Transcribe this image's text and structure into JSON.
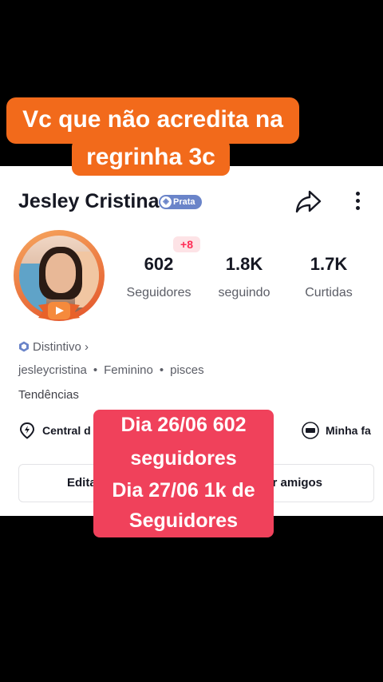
{
  "caption": {
    "line1": "Vc que não acredita na",
    "line2": "regrinha 3c"
  },
  "profile": {
    "name": "Jesley Cristina",
    "badge_label": "Prata",
    "stats": [
      {
        "value": "602",
        "label": "Seguidores",
        "delta": "+8"
      },
      {
        "value": "1.8K",
        "label": "seguindo"
      },
      {
        "value": "1.7K",
        "label": "Curtidas"
      }
    ],
    "distintivo": "Distintivo",
    "username": "jesleycristina",
    "gender": "Feminino",
    "sign": "pisces",
    "tendencias": "Tendências"
  },
  "quick_links": {
    "left": "Central d",
    "right": "Minha fa"
  },
  "buttons": {
    "edit": "Edita",
    "add_friends": "nar amigos"
  },
  "overlay": {
    "line1": "Dia 26/06 602",
    "line2": "seguidores",
    "line3": "Dia 27/06 1k de",
    "line4": "Seguidores"
  },
  "colors": {
    "caption_bg": "#f26a1b",
    "overlay_bg": "#f0415b",
    "badge_bg": "#6a84c9",
    "delta": "#fe2c55"
  }
}
